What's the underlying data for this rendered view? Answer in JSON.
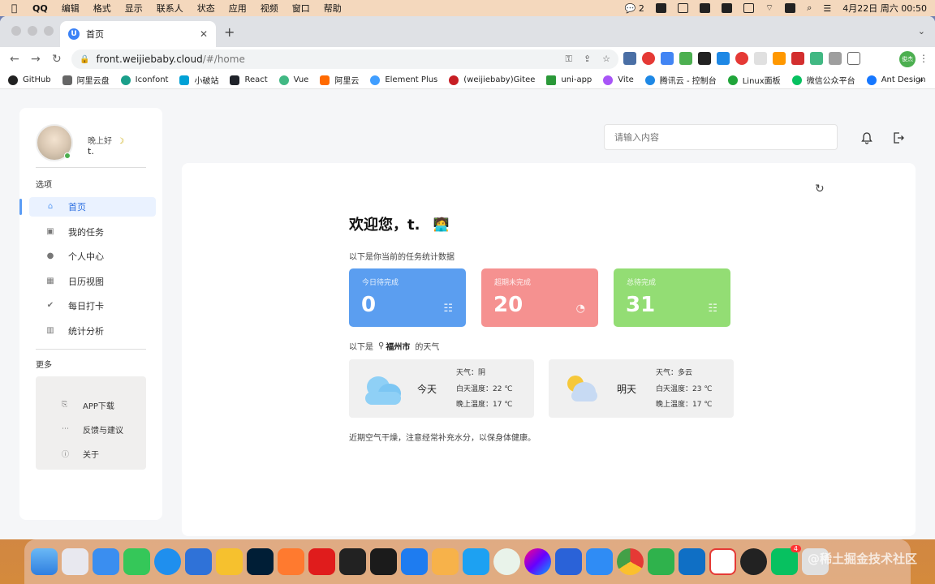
{
  "menubar": {
    "app_name": "QQ",
    "menus": [
      "编辑",
      "格式",
      "显示",
      "联系人",
      "状态",
      "应用",
      "视频",
      "窗口",
      "帮助"
    ],
    "notification_count": "2",
    "clock": "4月22日 周六 00:50"
  },
  "browser": {
    "tab_title": "首页",
    "tab_favicon": "U",
    "url_host": "front.weijiebaby.cloud",
    "url_path": "/#/home",
    "profile_label": "俊杰",
    "bookmarks": [
      "GitHub",
      "阿里云盘",
      "Iconfont",
      "小破站",
      "React",
      "Vue",
      "阿里云",
      "Element Plus",
      "(weijiebaby)Gitee",
      "uni-app",
      "Vite",
      "腾讯云 - 控制台",
      "Linux面板",
      "微信公众平台",
      "Ant Design"
    ]
  },
  "sidebar": {
    "greeting": "晚上好",
    "username": "t.",
    "options_label": "选项",
    "nav": [
      {
        "label": "首页",
        "icon": "home-icon"
      },
      {
        "label": "我的任务",
        "icon": "task-icon"
      },
      {
        "label": "个人中心",
        "icon": "user-icon"
      },
      {
        "label": "日历视图",
        "icon": "calendar-icon"
      },
      {
        "label": "每日打卡",
        "icon": "check-circle-icon"
      },
      {
        "label": "统计分析",
        "icon": "bar-chart-icon"
      }
    ],
    "more_label": "更多",
    "more_items": [
      {
        "label": "APP下载",
        "icon": "download-icon"
      },
      {
        "label": "反馈与建议",
        "icon": "feedback-icon"
      },
      {
        "label": "关于",
        "icon": "info-icon"
      }
    ]
  },
  "header": {
    "search_placeholder": "请输入内容"
  },
  "main": {
    "welcome": "欢迎您，t.",
    "stats_intro": "以下是你当前的任务统计数据",
    "stats": [
      {
        "label": "今日待完成",
        "value": "0",
        "color": "#5b9ef0"
      },
      {
        "label": "超期未完成",
        "value": "20",
        "color": "#f59190"
      },
      {
        "label": "总待完成",
        "value": "31",
        "color": "#93dd74"
      }
    ],
    "weather_prefix": "以下是",
    "city": "福州市",
    "weather_suffix": "的天气",
    "weather": [
      {
        "day": "今天",
        "condition": "天气：阴",
        "day_temp": "白天温度：22 ℃",
        "night_temp": "晚上温度：17 ℃"
      },
      {
        "day": "明天",
        "condition": "天气：多云",
        "day_temp": "白天温度：23 ℃",
        "night_temp": "晚上温度：17 ℃"
      }
    ],
    "advice": "近期空气干燥，注意经常补充水分，以保身体健康。"
  },
  "dock": {
    "apps": [
      "finder",
      "launchpad",
      "mail",
      "facetime",
      "safari",
      "network",
      "notes-yellow",
      "photoshop",
      "pen",
      "youdao",
      "terminal",
      "activity-monitor",
      "lanhu",
      "fusion",
      "teambition",
      "wechat-work",
      "arc",
      "monitor",
      "feishu",
      "chrome",
      "hbuilder",
      "vscode",
      "wps",
      "qq",
      "wechat",
      "trash"
    ],
    "badge": "4"
  },
  "watermark": "@稀土掘金技术社区"
}
